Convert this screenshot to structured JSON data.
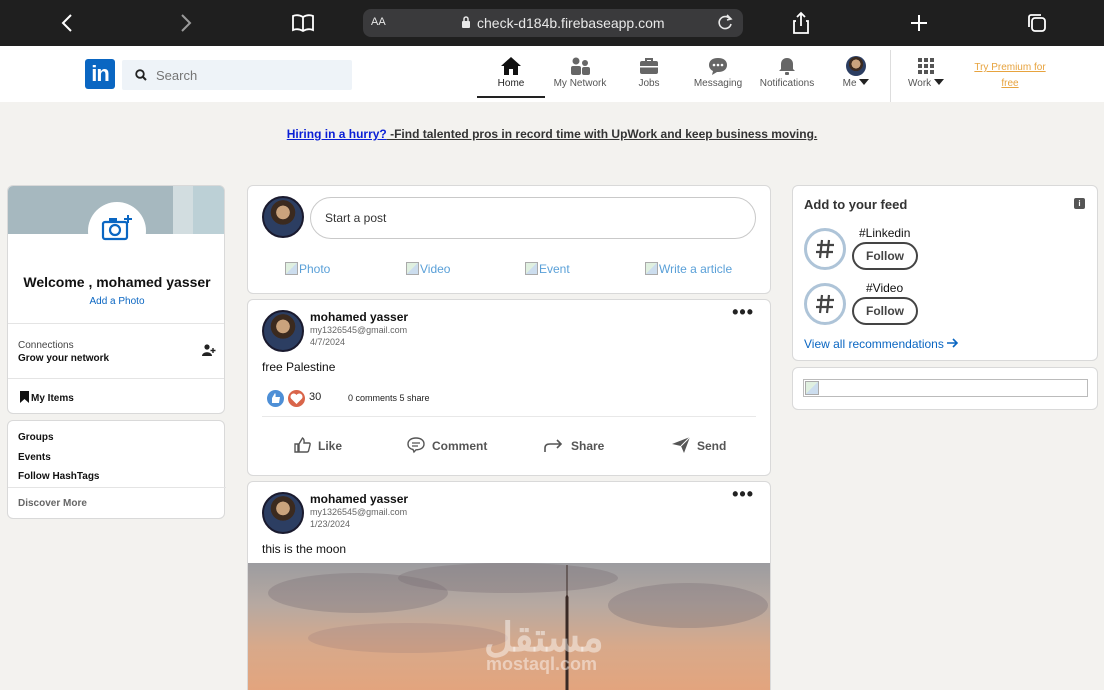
{
  "browser": {
    "text_size_label": "AA",
    "url": "check-d184b.firebaseapp.com"
  },
  "nav": {
    "search_placeholder": "Search",
    "items": [
      {
        "label": "Home",
        "icon": "home-icon"
      },
      {
        "label": "My Network",
        "icon": "network-icon"
      },
      {
        "label": "Jobs",
        "icon": "briefcase-icon"
      },
      {
        "label": "Messaging",
        "icon": "chat-icon"
      },
      {
        "label": "Notifications",
        "icon": "bell-icon"
      },
      {
        "label": "Me",
        "icon": "avatar"
      },
      {
        "label": "Work",
        "icon": "grid-icon"
      }
    ],
    "premium_line1": "Try Premium for",
    "premium_line2": "free",
    "accent": "#0a66c2"
  },
  "banner": {
    "link": "Hiring in a hurry?",
    "text": " -Find talented pros in record time with UpWork and keep business moving."
  },
  "profile": {
    "welcome": "Welcome , mohamed yasser",
    "add_photo": "Add a Photo",
    "connections_label": "Connections",
    "grow_label": "Grow your network",
    "my_items": "My Items"
  },
  "links": {
    "groups": "Groups",
    "events": "Events",
    "follow_hashtags": "Follow HashTags",
    "discover_more": "Discover More"
  },
  "composer": {
    "placeholder": "Start a post",
    "actions": [
      "Photo",
      "Video",
      "Event",
      "Write a article"
    ]
  },
  "posts": [
    {
      "author": "mohamed yasser",
      "email": "my1326545@gmail.com",
      "date": "4/7/2024",
      "text": "free Palestine",
      "reactions": "30",
      "meta": "0 comments  5 share",
      "actions": [
        "Like",
        "Comment",
        "Share",
        "Send"
      ]
    },
    {
      "author": "mohamed yasser",
      "email": "my1326545@gmail.com",
      "date": "1/23/2024",
      "text": "this is the moon",
      "watermark_ar": "مستقل",
      "watermark_en": "mostaql.com"
    }
  ],
  "feed": {
    "title": "Add to your feed",
    "tags": [
      {
        "name": "#Linkedin",
        "button": "Follow"
      },
      {
        "name": "#Video",
        "button": "Follow"
      }
    ],
    "view_all": "View all recommendations"
  }
}
